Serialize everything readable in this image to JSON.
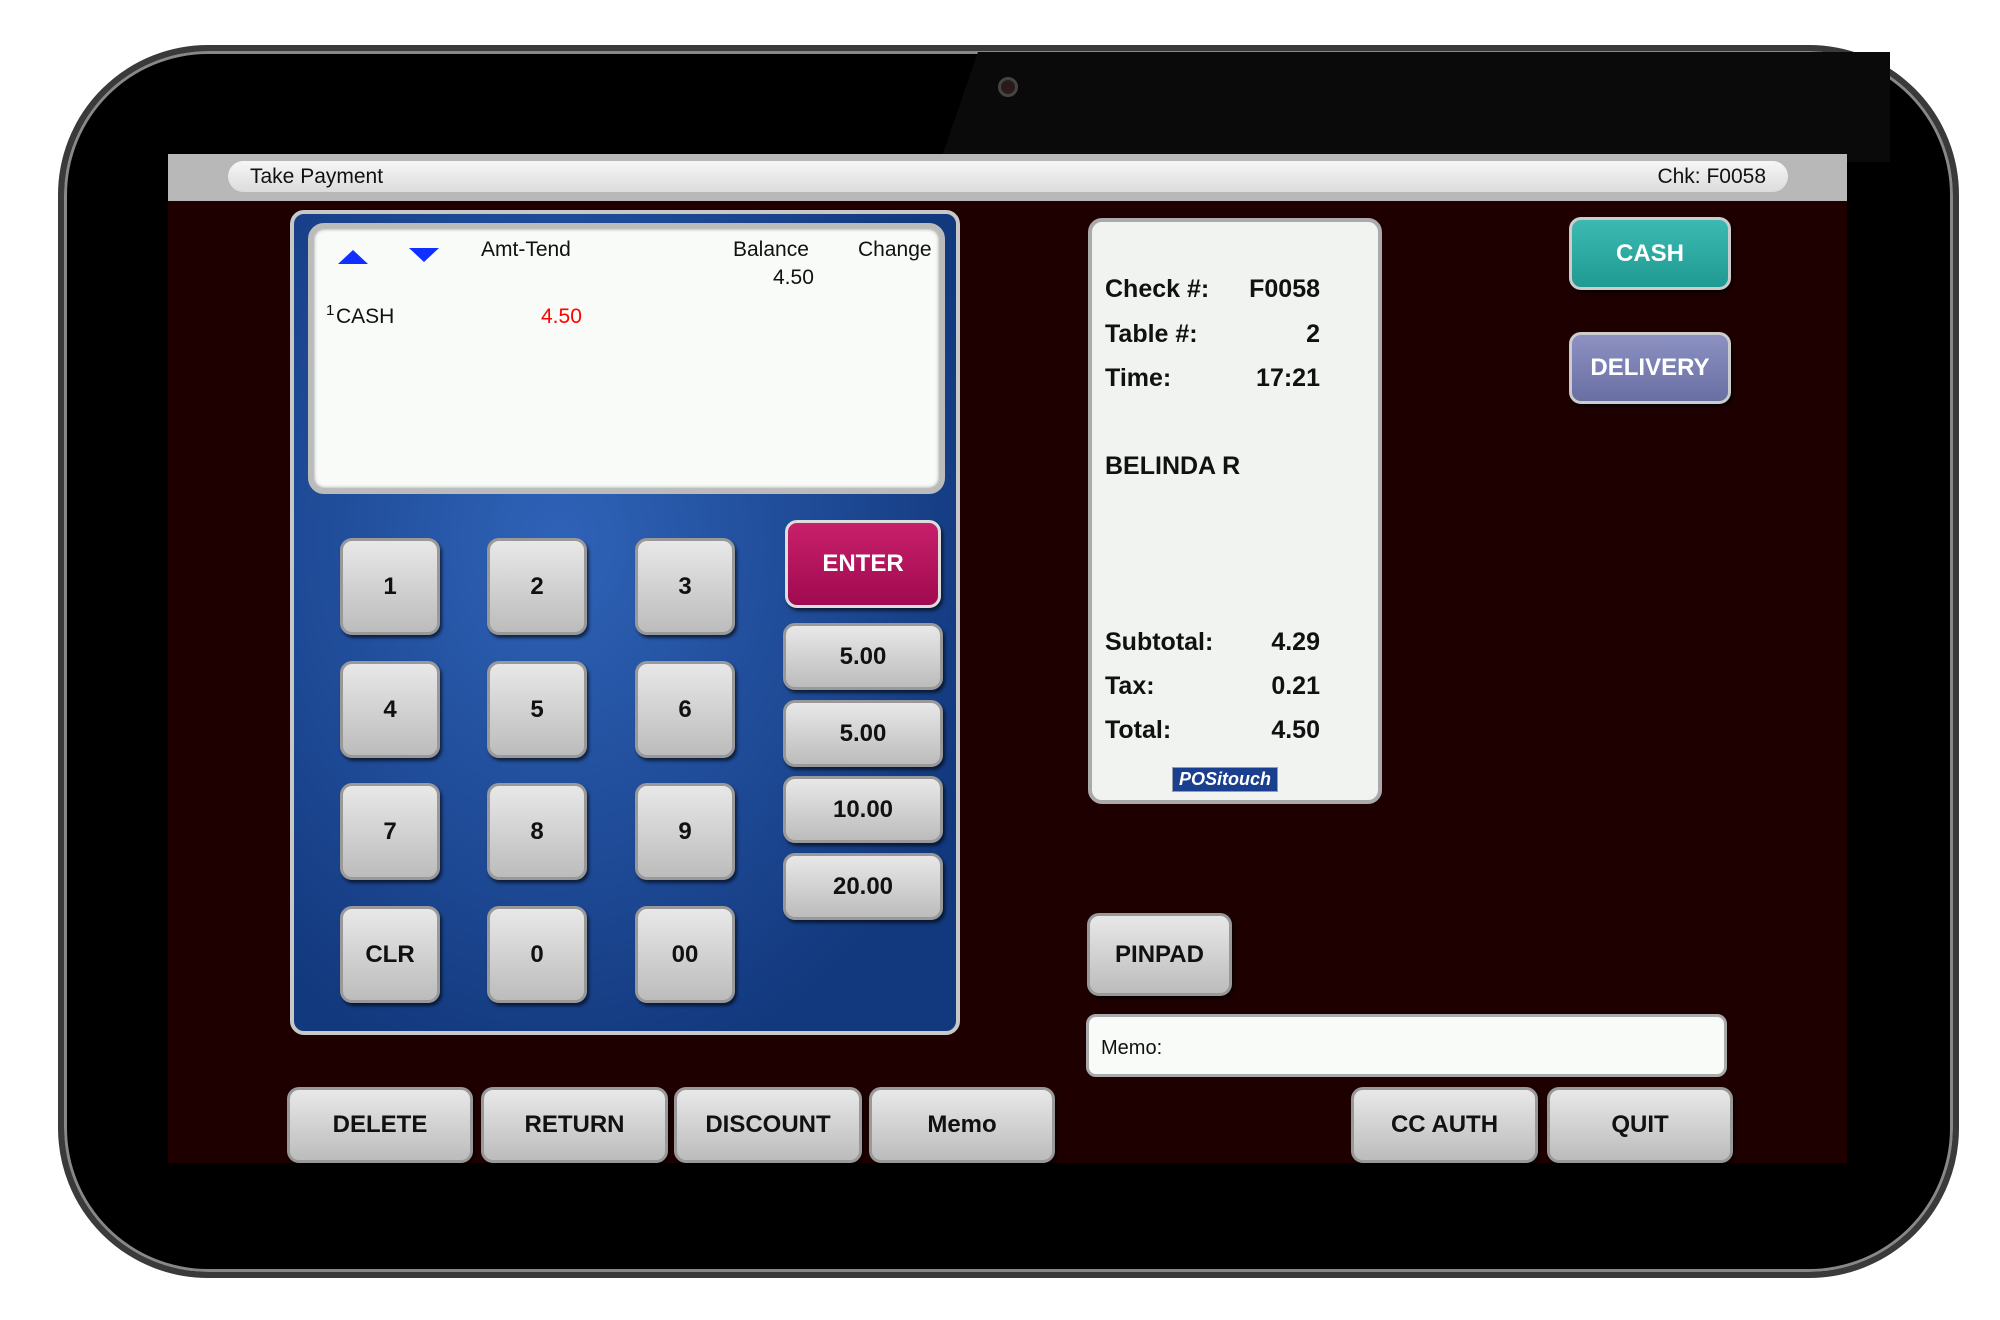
{
  "title": "Take Payment",
  "check_label": "Chk: F0058",
  "tender_list": {
    "headers": {
      "amt_tend": "Amt-Tend",
      "balance": "Balance",
      "change": "Change"
    },
    "balance_value": "4.50",
    "rows": [
      {
        "index": "1",
        "type": "CASH",
        "amount": "4.50"
      }
    ]
  },
  "keypad": [
    "1",
    "2",
    "3",
    "4",
    "5",
    "6",
    "7",
    "8",
    "9",
    "CLR",
    "0",
    "00"
  ],
  "enter_label": "ENTER",
  "quick_amounts": [
    "5.00",
    "5.00",
    "10.00",
    "20.00"
  ],
  "receipt": {
    "check_label": "Check #:",
    "check_value": "F0058",
    "table_label": "Table #:",
    "table_value": "2",
    "time_label": "Time:",
    "time_value": "17:21",
    "server": "BELINDA R",
    "subtotal_label": "Subtotal:",
    "subtotal_value": "4.29",
    "tax_label": "Tax:",
    "tax_value": "0.21",
    "total_label": "Total:",
    "total_value": "4.50",
    "logo": "POSitouch"
  },
  "side_buttons": {
    "cash": "CASH",
    "delivery": "DELIVERY",
    "pinpad": "PINPAD"
  },
  "memo_label": "Memo:",
  "bottom_buttons": {
    "delete": "DELETE",
    "return": "RETURN",
    "discount": "DISCOUNT",
    "memo": "Memo",
    "cc_auth": "CC AUTH",
    "quit": "QUIT"
  },
  "colors": {
    "cash": "#2aa59e",
    "delivery": "#7a7fb0",
    "enter": "#b0105a",
    "background": "#1e0000",
    "panel": "#1f4ea0",
    "amount_red": "#ff0000"
  }
}
